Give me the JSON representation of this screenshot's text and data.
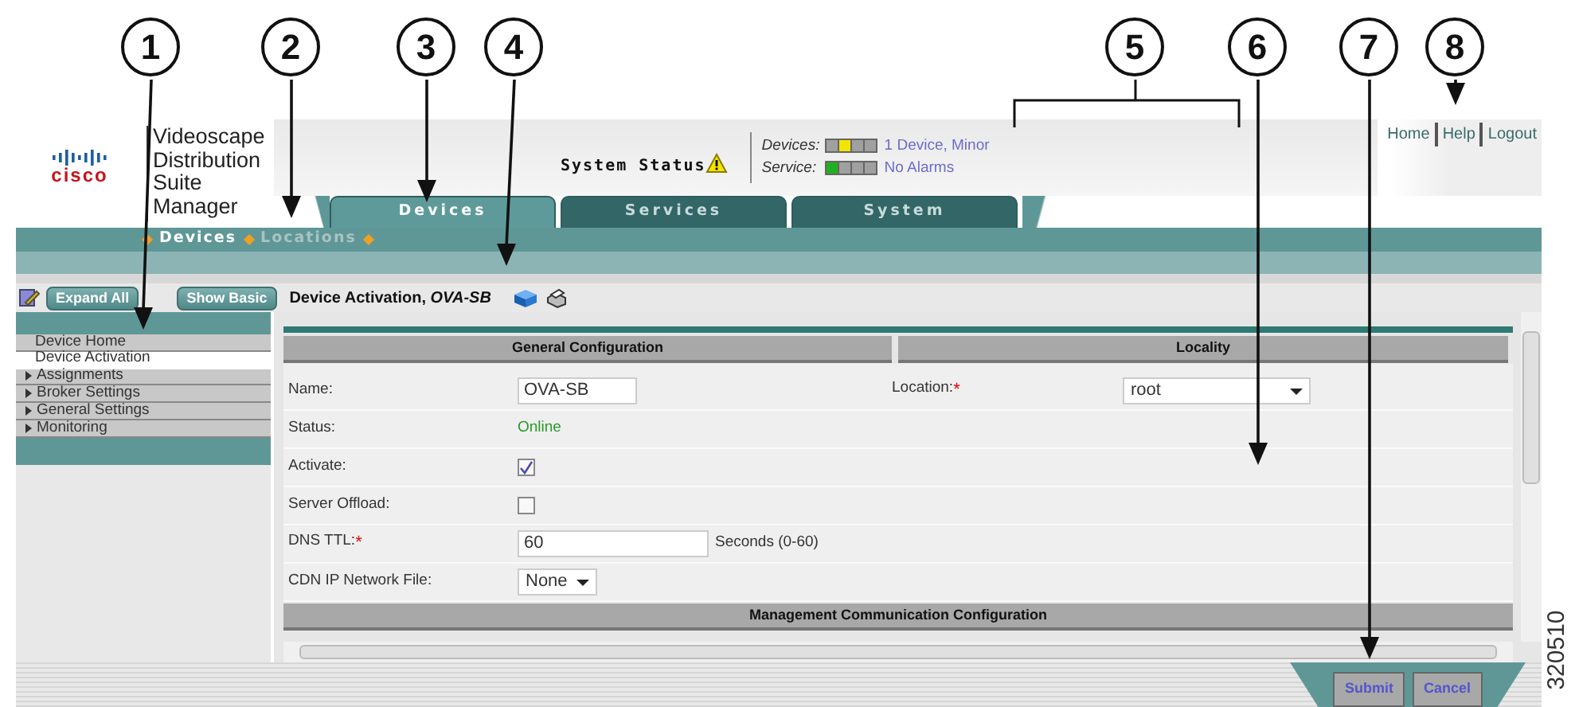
{
  "callouts": [
    "1",
    "2",
    "3",
    "4",
    "5",
    "6",
    "7",
    "8"
  ],
  "figure_id": "320510",
  "header": {
    "logo": "cisco",
    "product_name": "Videoscape Distribution Suite Manager",
    "system_status": "System Status",
    "status_rows": [
      {
        "label": "Devices:",
        "leds": [
          {
            "color": "#a0a0a0"
          },
          {
            "color": "#f2e600"
          },
          {
            "color": "#a0a0a0"
          },
          {
            "color": "#a0a0a0"
          }
        ],
        "link": "1 Device, Minor"
      },
      {
        "label": "Service:",
        "leds": [
          {
            "color": "#22b022"
          },
          {
            "color": "#a0a0a0"
          },
          {
            "color": "#a0a0a0"
          },
          {
            "color": "#a0a0a0"
          }
        ],
        "link": "No Alarms"
      }
    ],
    "links": [
      "Home",
      "Help",
      "Logout"
    ]
  },
  "tabs": [
    {
      "label": "Devices",
      "selected": true
    },
    {
      "label": "Services",
      "selected": false
    },
    {
      "label": "System",
      "selected": false
    }
  ],
  "breadcrumbs": [
    {
      "label": "Devices",
      "selected": true
    },
    {
      "label": "Locations",
      "selected": false
    }
  ],
  "toolbar": {
    "buttons": [
      "Expand All",
      "Show Basic"
    ],
    "page_title": "Device Activation, *OVA-SB*"
  },
  "sidebar": {
    "items": [
      {
        "label": "Device Home",
        "kind": "link",
        "selected": false
      },
      {
        "label": "Device Activation",
        "kind": "link",
        "selected": true
      },
      {
        "label": "Assignments",
        "kind": "group",
        "selected": false
      },
      {
        "label": "Broker Settings",
        "kind": "group",
        "selected": false
      },
      {
        "label": "General Settings",
        "kind": "group",
        "selected": false
      },
      {
        "label": "Monitoring",
        "kind": "group",
        "selected": false
      }
    ]
  },
  "form": {
    "sections": [
      "General Configuration",
      "Locality"
    ],
    "location": {
      "label": "Location:",
      "required_mark": "*",
      "value": "root"
    },
    "rows": [
      {
        "label": "Name:",
        "kind": "text",
        "value": "OVA-SB"
      },
      {
        "label": "Status:",
        "kind": "status",
        "value": "Online"
      },
      {
        "label": "Activate:",
        "kind": "checkbox",
        "checked": true
      },
      {
        "label": "Server Offload:",
        "kind": "checkbox",
        "checked": false
      },
      {
        "label": "DNS TTL:",
        "kind": "text",
        "required_mark": "*",
        "value": "60",
        "hint": "Seconds (0-60)"
      },
      {
        "label": "CDN IP Network File:",
        "kind": "select",
        "value": "None"
      }
    ],
    "next_section": "Management Communication Configuration"
  },
  "buttons": [
    "Submit",
    "Cancel"
  ]
}
